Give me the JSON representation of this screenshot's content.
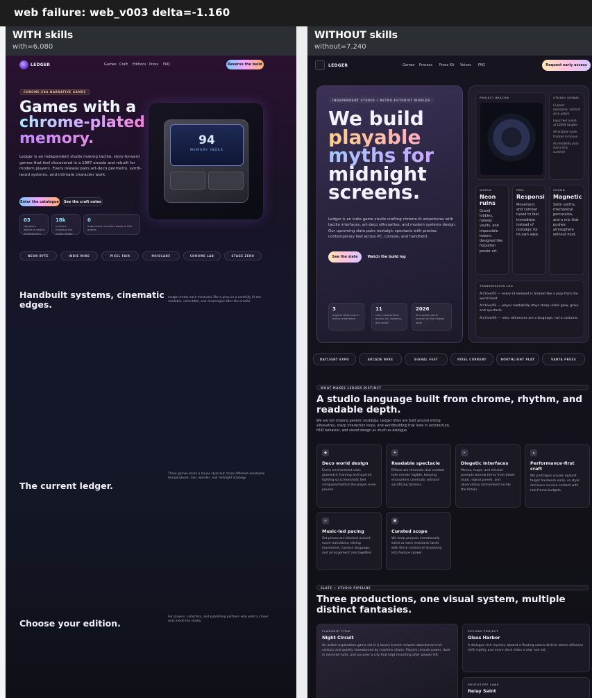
{
  "header": {
    "title": "web failure: web_v003  delta=-1.160"
  },
  "panels": {
    "left": {
      "heading": "WITH skills",
      "score": "with=6.080"
    },
    "right": {
      "heading": "WITHOUT skills",
      "score": "without=7.240"
    }
  },
  "left": {
    "brand": "LEDGER",
    "nav": [
      "Games",
      "Craft",
      "Editions",
      "Press",
      "FAQ"
    ],
    "cta": "Reserve the build",
    "tag": "CHROME-ERA NARRATIVE GAMES",
    "hero_lines": [
      "Games with a",
      "chrome-plated",
      "memory."
    ],
    "hero_body": "Ledger is an independent studio making tactile, story-forward games that feel discovered in a 1987 arcade and rebuilt for modern players. Every release pairs art-deco geometry, synth-laced systems, and intimate character work.",
    "btn_primary": "Enter the catalogue",
    "btn_secondary": "See the craft notes",
    "stats": [
      {
        "value": "03",
        "label": "signature worlds in active development"
      },
      {
        "value": "18k",
        "label": "curators following the studio ledger"
      },
      {
        "value": "0",
        "label": "outsourced narrative beats in flier quests"
      }
    ],
    "device_value": "94",
    "device_label": "MEMORY INDEX",
    "chips": [
      "NEON BYTE",
      "INDIE WIRE",
      "PIXEL FAIR",
      "NOISCADE",
      "CHROME LAB",
      "STAGE ZERO"
    ],
    "sections": [
      {
        "title": "Handbuilt systems, cinematic edges.",
        "note": "Ledger treats each mechanic like a prop on a carefully lit set: readable, collectible, and meaningful after the credits."
      },
      {
        "title": "The current ledger.",
        "note": "Three games share a house style but chase different emotional temperatures: noir, wonder, and midnight strategy."
      },
      {
        "title": "Choose your edition.",
        "note": "For players, collectors, and publishing partners who want a closer seat inside the studio."
      }
    ]
  },
  "right": {
    "brand": "LEDGER",
    "nav": [
      "Games",
      "Process",
      "Press Kit",
      "Voices",
      "FAQ"
    ],
    "cta": "Request early access",
    "tag": "INDEPENDENT STUDIO • RETRO-FUTURIST WORLDS",
    "hero_lines": [
      "We build",
      "playable",
      "myths for",
      "midnight",
      "screens."
    ],
    "hero_body": "Ledger is an indie game studio crafting chrome-lit adventures with tactile interfaces, art-deco silhouettes, and modern systems design. Our upcoming slate pairs nostalgic spectacle with precise, contemporary feel across PC, console, and handheld.",
    "btn_primary": "See the slate",
    "btn_secondary": "Watch the build log",
    "stats": [
      {
        "value": "3",
        "label": "original titles now in active production"
      },
      {
        "value": "11",
        "label": "core collaborators across art, systems, and audio"
      },
      {
        "value": "2026",
        "label": "first public demo season for the Ledger label"
      }
    ],
    "beacon_caption": "PROJECT BEACON",
    "signal": {
      "caption": "STUDIO SIGNAL",
      "items": [
        "Current milestone: vertical slice polish",
        "Input feel tuned at 120Hz targets",
        "All original score tracked in-house",
        "Accessibility pass starts this summer"
      ]
    },
    "tiles": [
      {
        "caption": "WORLD",
        "title": "Neon ruins",
        "body": "Grand lobbies, railway vaults, and impossible towers designed like forgotten poster art."
      },
      {
        "caption": "FEEL",
        "title": "Responsive",
        "body": "Movement and combat tuned to feel immediate instead of nostalgic for its own sake."
      },
      {
        "caption": "SOUND",
        "title": "Magnetic",
        "body": "Satin synths, mechanical percussion, and a mix that pushes atmosphere without mud."
      }
    ],
    "log": {
      "caption": "TRANSMISSION LOG",
      "items": [
        "Archive/01 — every UI element is treated like a prop from the world itself.",
        "Archive/02 — player readability stays sharp under glow, grain, and spectacle.",
        "Archive/03 — retro references are a language, not a costume."
      ]
    },
    "chips": [
      "DAYLIGHT EXPO",
      "ARCADE WIRE",
      "SIGNAL FEST",
      "PIXEL CURRENT",
      "NORTHLIGHT PLAY",
      "VANTA PRESS"
    ],
    "distinct": {
      "tag": "WHAT MAKES LEDGER DISTINCT",
      "title": "A studio language built from chrome, rhythm, and readable depth.",
      "body": "We are not chasing generic nostalgia. Ledger titles are built around strong silhouettes, sharp interaction loops, and worldbuilding that lives in architecture, HUD behavior, and sound design as much as dialogue.",
      "cards": [
        {
          "icon": "◆",
          "title": "Deco world design",
          "body": "Every environment uses geometric framing and layered lighting so screenshots feel composed before the player even pauses."
        },
        {
          "icon": "✦",
          "title": "Readable spectacle",
          "body": "Effects are dramatic, but combat tells remain legible, keeping encounters cinematic without sacrificing fairness."
        },
        {
          "icon": "⌁",
          "title": "Diegetic interfaces",
          "body": "Menus, maps, and mission prompts borrow forms from ticket stubs, signal panels, and observatory instruments inside the fiction."
        },
        {
          "icon": "▴",
          "title": "Performance-first craft",
          "body": "We prototype visuals against target hardware early, so style decisions survive contact with real frame budgets."
        },
        {
          "icon": "≈",
          "title": "Music-led pacing",
          "body": "Set pieces are blocked around score transitions, letting movement, camera language, and arrangement rise together."
        },
        {
          "icon": "▣",
          "title": "Curated scope",
          "body": "We keep projects intentionally sized so each mechanic lands with finish instead of dissolving into feature sprawl."
        }
      ]
    },
    "slate": {
      "tag": "SLATE + STUDIO PIPELINE",
      "title": "Three productions, one visual system, multiple distinct fantasies.",
      "projects": [
        {
          "caption": "FLAGSHIP TITLE",
          "title": "Night Circuit",
          "body": "An action-exploration game set in a luxury transit network abandoned mid-century and quietly reawakened by machine choirs. Players reroute power, duel in mirrored halls, and uncover a city that kept recording after people left."
        },
        {
          "caption": "SECOND PROJECT",
          "title": "Glass Harbor",
          "body": "A dialogue-rich mystery aboard a floating casino district where alliances shift nightly and every deck hides a new rule set."
        },
        {
          "caption": "PROTOTYPE LANE",
          "title": "Relay Saint",
          "body": ""
        }
      ]
    }
  }
}
